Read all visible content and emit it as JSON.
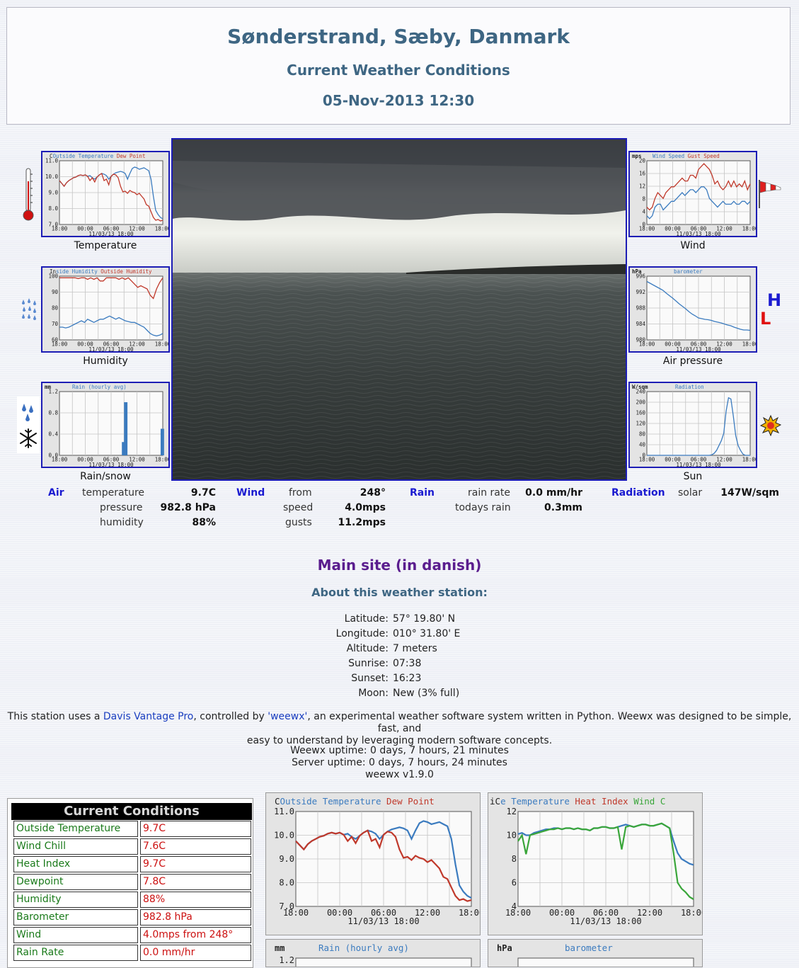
{
  "header": {
    "location": "Sønderstrand, Sæby, Danmark",
    "subtitle": "Current Weather Conditions",
    "datetime": "05-Nov-2013 12:30"
  },
  "thumbnails": [
    {
      "caption": "Temperature",
      "icon": "thermometer-icon"
    },
    {
      "caption": "Humidity",
      "icon": "raindrops-icon"
    },
    {
      "caption": "Rain/snow",
      "icon": "rain-snow-icon"
    },
    {
      "caption": "Wind",
      "icon": "windsock-icon"
    },
    {
      "caption": "Air pressure",
      "icon": "high-low-icon"
    },
    {
      "caption": "Sun",
      "icon": "sun-icon"
    }
  ],
  "pressure_icon": {
    "high": "H",
    "low": "L"
  },
  "current": {
    "air": {
      "heading": "Air",
      "temperature_label": "temperature",
      "temperature": "9.7C",
      "pressure_label": "pressure",
      "pressure": "982.8 hPa",
      "humidity_label": "humidity",
      "humidity": "88%"
    },
    "wind": {
      "heading": "Wind",
      "from_label": "from",
      "from": "248°",
      "speed_label": "speed",
      "speed": "4.0mps",
      "gusts_label": "gusts",
      "gusts": "11.2mps"
    },
    "rain": {
      "heading": "Rain",
      "rate_label": "rain rate",
      "rate": "0.0 mm/hr",
      "today_label": "todays rain",
      "today": "0.3mm"
    },
    "radiation": {
      "heading": "Radiation",
      "solar_label": "solar",
      "solar": "147W/sqm"
    }
  },
  "main_site_link": "Main site (in danish)",
  "about": {
    "title": "About this weather station:",
    "rows": [
      {
        "label": "Latitude:",
        "value": "57° 19.80' N"
      },
      {
        "label": "Longitude:",
        "value": "010° 31.80' E"
      },
      {
        "label": "Altitude:",
        "value": "7 meters"
      },
      {
        "label": "Sunrise:",
        "value": "07:38"
      },
      {
        "label": "Sunset:",
        "value": "16:23"
      },
      {
        "label": "Moon:",
        "value": "New (3% full)"
      }
    ]
  },
  "description": {
    "before": "This station uses a ",
    "link1": "Davis Vantage Pro",
    "middle": ", controlled by ",
    "link2": "'weewx'",
    "after": ", an experimental weather software system written in Python. Weewx was designed to be simple, fast, and",
    "line2": "easy to understand by leveraging modern software concepts."
  },
  "uptime": {
    "weewx": "Weewx uptime: 0 days, 7 hours, 21 minutes",
    "server": "Server uptime: 0 days, 7 hours, 24 minutes",
    "version": "weewx v1.9.0"
  },
  "current_conditions": {
    "title": "Current Conditions",
    "rows": [
      {
        "label": "Outside Temperature",
        "value": "9.7C"
      },
      {
        "label": "Wind Chill",
        "value": "7.6C"
      },
      {
        "label": "Heat Index",
        "value": "9.7C"
      },
      {
        "label": "Dewpoint",
        "value": "7.8C"
      },
      {
        "label": "Humidity",
        "value": "88%"
      },
      {
        "label": "Barometer",
        "value": "982.8 hPa"
      },
      {
        "label": "Wind",
        "value": "4.0mps from 248°"
      },
      {
        "label": "Rain Rate",
        "value": "0.0 mm/hr"
      }
    ]
  },
  "colors": {
    "series_blue": "#3b7bbf",
    "series_red": "#c0392b",
    "series_green": "#3aa63a",
    "frame_blue": "#1d1db5"
  },
  "plots": {
    "temp": {
      "title_parts": [
        {
          "text": "C",
          "color": "#222"
        },
        {
          "text": "Outside Temperature",
          "color": "#3b7bbf"
        },
        {
          "text": " Dew Point",
          "color": "#c0392b"
        }
      ],
      "yticks": [
        "11.0",
        "10.0",
        "9.0",
        "8.0",
        "7.0"
      ],
      "xticks": [
        "18:00",
        "00:00",
        "06:00",
        "12:00",
        "18:00"
      ],
      "date": "11/03/13 18:00",
      "ymin": 7,
      "ymax": 11.5,
      "series": [
        {
          "name": "Outside Temperature",
          "color": "#3b7bbf",
          "values": [
            10.1,
            9.9,
            9.7,
            9.95,
            10.1,
            10.2,
            10.3,
            10.35,
            10.45,
            10.5,
            10.45,
            10.5,
            10.4,
            10.45,
            10.3,
            10.2,
            10.35,
            10.5,
            10.6,
            10.55,
            10.45,
            10.2,
            10.4,
            10.55,
            10.65,
            10.7,
            10.75,
            10.7,
            10.6,
            10.2,
            10.6,
            10.95,
            11.05,
            11.0,
            10.9,
            10.95,
            11.0,
            10.9,
            10.8,
            10.2,
            9.0,
            8.0,
            7.7,
            7.5,
            7.4
          ]
        },
        {
          "name": "Dew Point",
          "color": "#c0392b",
          "values": [
            10.1,
            9.9,
            9.7,
            9.95,
            10.1,
            10.2,
            10.3,
            10.35,
            10.45,
            10.5,
            10.45,
            10.5,
            10.4,
            10.1,
            10.3,
            10.0,
            10.35,
            10.5,
            10.6,
            10.1,
            10.2,
            9.8,
            10.4,
            10.55,
            10.5,
            10.3,
            9.7,
            9.3,
            9.35,
            9.2,
            9.4,
            9.3,
            9.25,
            9.1,
            9.2,
            9.0,
            8.8,
            8.4,
            8.3,
            7.9,
            7.5,
            7.3,
            7.35,
            7.25,
            7.3
          ]
        }
      ]
    },
    "humidity": {
      "title_parts": [
        {
          "text": "In",
          "color": "#222"
        },
        {
          "text": "side Humidity",
          "color": "#3b7bbf"
        },
        {
          "text": " Outside Humidity",
          "color": "#c0392b"
        }
      ],
      "yticks": [
        "100",
        "90",
        "80",
        "70",
        "60"
      ],
      "xticks": [
        "18:00",
        "00:00",
        "06:00",
        "12:00",
        "18:00"
      ],
      "date": "11/03/13 18:00",
      "ymin": 60,
      "ymax": 100,
      "series": [
        {
          "name": "Inside Humidity",
          "color": "#3b7bbf",
          "values": [
            68,
            68,
            67.5,
            68,
            69,
            70,
            71,
            72,
            71,
            73,
            72,
            71,
            72,
            73,
            73,
            74,
            75,
            74,
            73,
            74,
            73,
            72,
            71.5,
            71,
            71,
            70,
            69,
            68,
            66,
            64,
            63,
            62.5,
            63,
            64
          ]
        },
        {
          "name": "Outside Humidity",
          "color": "#c0392b",
          "values": [
            99,
            99,
            99,
            99,
            99,
            99,
            98.5,
            99,
            99,
            98,
            99,
            98,
            99,
            97,
            97,
            99,
            99,
            99,
            99,
            98,
            99,
            98,
            99,
            97,
            95,
            93,
            94,
            93,
            92,
            88,
            86,
            92,
            96,
            99
          ]
        }
      ]
    },
    "rain": {
      "title_parts": [
        {
          "text": "Rain (hourly avg)",
          "color": "#3b7bbf"
        }
      ],
      "unit": "mm",
      "yticks": [
        "1.2",
        "0.8",
        "0.4",
        "0.0"
      ],
      "xticks": [
        "18:00",
        "00:00",
        "06:00",
        "12:00",
        "18:00"
      ],
      "date": "11/03/13 18:00",
      "ymin": 0,
      "ymax": 1.2,
      "bars": [
        {
          "slot": 29,
          "value": 0.25
        },
        {
          "slot": 30,
          "value": 1.0
        },
        {
          "slot": 47,
          "value": 0.5
        }
      ],
      "slots": 48
    },
    "wind": {
      "title_parts": [
        {
          "text": "Wind Speed",
          "color": "#3b7bbf"
        },
        {
          "text": " Gust Speed",
          "color": "#c0392b"
        }
      ],
      "unit": "mps",
      "yticks": [
        "20",
        "16",
        "12",
        "8",
        "4",
        "0"
      ],
      "xticks": [
        "18:00",
        "00:00",
        "06:00",
        "12:00",
        "18:00"
      ],
      "date": "11/03/13 18:00",
      "ymin": 0,
      "ymax": 22,
      "series": [
        {
          "name": "Wind Speed",
          "color": "#3b7bbf",
          "values": [
            3,
            2,
            3,
            6,
            7,
            7,
            5,
            6,
            7,
            8,
            8,
            9,
            10,
            11,
            10,
            11,
            12,
            12,
            11,
            12,
            13,
            13,
            12,
            9,
            8,
            7,
            6,
            7,
            8,
            7,
            7,
            7,
            8,
            7,
            7,
            8,
            8,
            7,
            8
          ]
        },
        {
          "name": "Gust Speed",
          "color": "#c0392b",
          "values": [
            6,
            5,
            6,
            9,
            11,
            10,
            9,
            11,
            12,
            13,
            13,
            14,
            15,
            16,
            15,
            15,
            17,
            17,
            16,
            19,
            20,
            21,
            20,
            19,
            17,
            14,
            15,
            13,
            12,
            13,
            15,
            13,
            15,
            13,
            14,
            13,
            15,
            12,
            14
          ]
        }
      ]
    },
    "barometer": {
      "title_parts": [
        {
          "text": "barometer",
          "color": "#3b7bbf"
        }
      ],
      "unit": "hPa",
      "yticks": [
        "996",
        "992",
        "988",
        "984",
        "980"
      ],
      "xticks": [
        "18:00",
        "00:00",
        "06:00",
        "12:00",
        "18:00"
      ],
      "date": "11/03/13 18:00",
      "ymin": 980,
      "ymax": 998,
      "series": [
        {
          "name": "barometer",
          "color": "#3b7bbf",
          "values": [
            996.5,
            996,
            995.5,
            995,
            994.5,
            994,
            993.2,
            992.5,
            991.8,
            991,
            990.2,
            989.5,
            988.8,
            988,
            987.3,
            986.8,
            986.2,
            986,
            985.8,
            985.7,
            985.5,
            985.2,
            985,
            984.8,
            984.5,
            984.2,
            984,
            983.6,
            983.3,
            983,
            982.8,
            982.8,
            982.7
          ]
        }
      ]
    },
    "radiation": {
      "title_parts": [
        {
          "text": "Radiation",
          "color": "#3b7bbf"
        }
      ],
      "unit": "W/sqm",
      "yticks": [
        "240",
        "200",
        "160",
        "120",
        "80",
        "40",
        "0"
      ],
      "xticks": [
        "18:00",
        "00:00",
        "06:00",
        "12:00",
        "18:00"
      ],
      "date": "11/03/13 18:00",
      "ymin": 0,
      "ymax": 260,
      "series": [
        {
          "name": "Radiation",
          "color": "#3b7bbf",
          "values": [
            0,
            0,
            0,
            0,
            0,
            0,
            0,
            0,
            0,
            0,
            0,
            0,
            0,
            0,
            0,
            0,
            0,
            0,
            0,
            0,
            0,
            0,
            0,
            0,
            0,
            0,
            0,
            2,
            8,
            20,
            40,
            60,
            90,
            180,
            235,
            230,
            160,
            80,
            40,
            20,
            5,
            0,
            0,
            0
          ]
        }
      ]
    },
    "big_temp": {
      "title_parts": [
        {
          "text": "C",
          "color": "#222"
        },
        {
          "text": "Outside Temperature",
          "color": "#3b7bbf"
        },
        {
          "text": " Dew Point",
          "color": "#c0392b"
        }
      ],
      "yticks": [
        "11.0",
        "10.0",
        "9.0",
        "8.0",
        "7.0"
      ],
      "xticks": [
        "18:00",
        "00:00",
        "06:00",
        "12:00",
        "18:00"
      ],
      "date": "11/03/13 18:00",
      "ymin": 7,
      "ymax": 11.5
    },
    "big_chill": {
      "title_parts": [
        {
          "text": "iC",
          "color": "#222"
        },
        {
          "text": "e Temperature",
          "color": "#3b7bbf"
        },
        {
          "text": " Heat Index",
          "color": "#c0392b"
        },
        {
          "text": " Wind C",
          "color": "#3aa63a"
        }
      ],
      "yticks": [
        "12",
        "10",
        "8",
        "6",
        "4"
      ],
      "xticks": [
        "18:00",
        "00:00",
        "06:00",
        "12:00",
        "18:00"
      ],
      "date": "11/03/13 18:00",
      "ymin": 4,
      "ymax": 12,
      "series": [
        {
          "name": "Heat Index",
          "color": "#3b7bbf",
          "values": [
            10.1,
            10.2,
            10.0,
            10.0,
            10.2,
            10.3,
            10.4,
            10.5,
            10.5,
            10.6,
            10.6,
            10.5,
            10.6,
            10.6,
            10.5,
            10.6,
            10.5,
            10.5,
            10.4,
            10.6,
            10.6,
            10.7,
            10.7,
            10.6,
            10.6,
            10.7,
            10.8,
            10.9,
            10.8,
            10.7,
            10.8,
            10.9,
            10.9,
            10.8,
            10.8,
            10.9,
            11.0,
            10.8,
            10.6,
            9.5,
            8.5,
            8.0,
            7.8,
            7.6,
            7.5
          ]
        },
        {
          "name": "Wind Chill",
          "color": "#3aa63a",
          "values": [
            9.5,
            10.0,
            8.4,
            10.0,
            10.1,
            10.2,
            10.3,
            10.4,
            10.5,
            10.5,
            10.6,
            10.5,
            10.6,
            10.6,
            10.5,
            10.6,
            10.5,
            10.5,
            10.4,
            10.6,
            10.6,
            10.7,
            10.7,
            10.6,
            10.6,
            10.7,
            8.8,
            10.7,
            10.8,
            10.7,
            10.8,
            10.9,
            10.9,
            10.8,
            10.8,
            10.9,
            11.0,
            10.8,
            10.6,
            8.5,
            6.0,
            5.5,
            5.2,
            4.8,
            4.6
          ]
        }
      ]
    },
    "big_rain": {
      "title_parts": [
        {
          "text": "Rain (hourly avg)",
          "color": "#3b7bbf"
        }
      ],
      "unit": "mm",
      "yticks": [
        "1.2"
      ]
    },
    "big_baro": {
      "title_parts": [
        {
          "text": "barometer",
          "color": "#3b7bbf"
        }
      ],
      "unit": "hPa"
    }
  }
}
